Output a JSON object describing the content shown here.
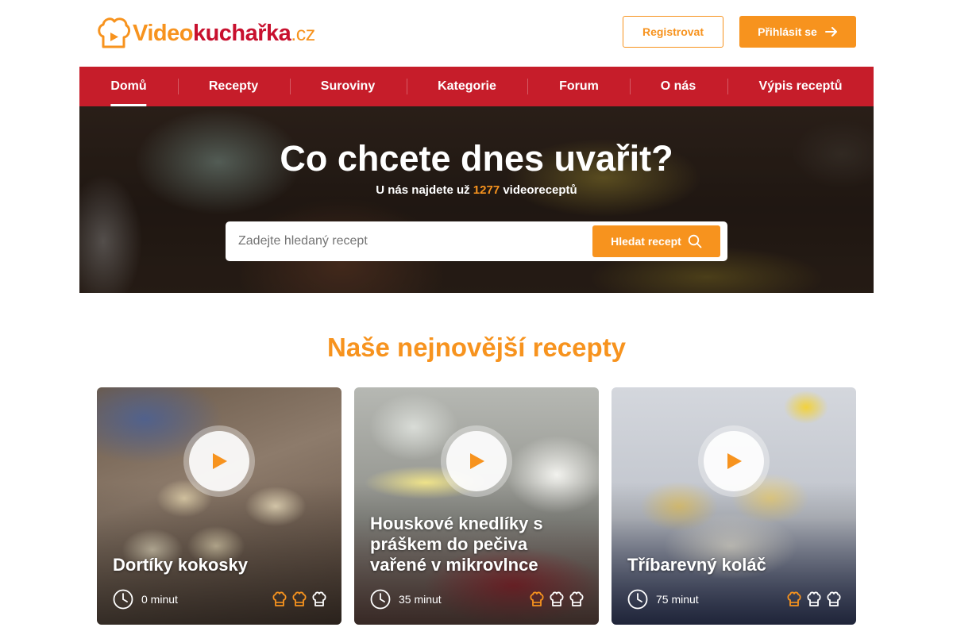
{
  "brand": {
    "part1": "Video",
    "part2": "kuchařka",
    "part3": ".cz",
    "primary_color": "#f7931e",
    "secondary_color": "#c61d2a"
  },
  "header": {
    "register_label": "Registrovat",
    "login_label": "Přihlásit se",
    "login_icon": "arrow-right-icon"
  },
  "nav": {
    "items": [
      {
        "label": "Domů",
        "active": true
      },
      {
        "label": "Recepty"
      },
      {
        "label": "Suroviny"
      },
      {
        "label": "Kategorie"
      },
      {
        "label": "Forum"
      },
      {
        "label": "O nás"
      },
      {
        "label": "Výpis receptů"
      }
    ]
  },
  "hero": {
    "title": "Co chcete dnes uvařit?",
    "subtitle_prefix": "U nás najdete už",
    "recipe_count": "1277",
    "subtitle_suffix": "videoreceptů",
    "search_placeholder": "Zadejte hledaný recept",
    "search_value": "",
    "search_button": "Hledat recept"
  },
  "section": {
    "title": "Naše nejnovější recepty"
  },
  "recipes": [
    {
      "title": "Dortíky kokosky",
      "time": "0 minut",
      "difficulty": 2,
      "difficulty_max": 3
    },
    {
      "title": "Houskové knedlíky s práškem do pečiva vařené v mikrovlnce",
      "time": "35 minut",
      "difficulty": 1,
      "difficulty_max": 3
    },
    {
      "title": "Tříbarevný koláč",
      "time": "75 minut",
      "difficulty": 1,
      "difficulty_max": 3
    }
  ]
}
